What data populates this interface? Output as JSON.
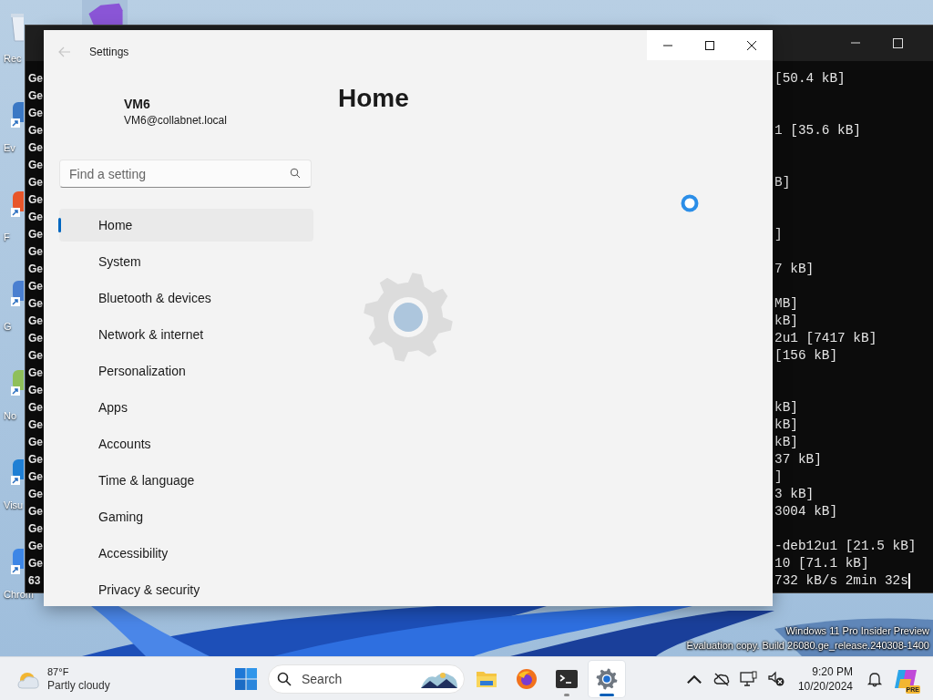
{
  "desktop": {
    "icons": [
      {
        "kind": "bin",
        "label": "Rec"
      },
      {
        "kind": "shortcut",
        "label": "Ev"
      },
      {
        "kind": "firefox",
        "label": "F"
      },
      {
        "kind": "globe",
        "label": "G"
      },
      {
        "kind": "notepad",
        "label": "No"
      },
      {
        "kind": "vscode",
        "label": "Visu"
      },
      {
        "kind": "chrome",
        "label": "Chrom"
      }
    ],
    "watermark": [
      "Windows 11 Pro Insider Preview",
      "Evaluation copy. Build 26080.ge_release.240308-1400"
    ]
  },
  "terminal": {
    "lines": [
      {
        "start": "Ge",
        "end": "[50.4 kB]"
      },
      {
        "start": "Ge"
      },
      {
        "start": "Ge"
      },
      {
        "start": "Ge",
        "end": "1 [35.6 kB]"
      },
      {
        "start": "Ge"
      },
      {
        "start": "Ge"
      },
      {
        "start": "Ge",
        "end": "B]"
      },
      {
        "start": "Ge"
      },
      {
        "start": "Ge"
      },
      {
        "start": "Ge",
        "end": "]"
      },
      {
        "start": "Ge"
      },
      {
        "start": "Ge",
        "end": "7 kB]"
      },
      {
        "start": "Ge"
      },
      {
        "start": "Ge",
        "end": "MB]"
      },
      {
        "start": "Ge",
        "end": "kB]"
      },
      {
        "start": "Ge",
        "end": "2u1 [7417 kB]"
      },
      {
        "start": "Ge",
        "end": "[156 kB]"
      },
      {
        "start": "Ge"
      },
      {
        "start": "Ge"
      },
      {
        "start": "Ge",
        "end": "kB]"
      },
      {
        "start": "Ge",
        "end": "kB]"
      },
      {
        "start": "Ge",
        "end": "kB]"
      },
      {
        "start": "Ge",
        "end": "37 kB]"
      },
      {
        "start": "Ge",
        "end": "]"
      },
      {
        "start": "Ge",
        "end": "3 kB]"
      },
      {
        "start": "Ge",
        "end": "3004 kB]"
      },
      {
        "start": "Ge"
      },
      {
        "start": "Ge",
        "end": "-deb12u1 [21.5 kB]"
      },
      {
        "start": "Ge",
        "end": "10 [71.1 kB]"
      },
      {
        "start": "63",
        "end": "732 kB/s 2min 32s",
        "cursor": true
      }
    ]
  },
  "settings": {
    "back": {
      "disabled": true
    },
    "title": "Settings",
    "user": {
      "name": "VM6",
      "email": "VM6@collabnet.local"
    },
    "search": {
      "placeholder": "Find a setting"
    },
    "nav": [
      {
        "label": "Home",
        "selected": true
      },
      {
        "label": "System",
        "selected": false
      },
      {
        "label": "Bluetooth & devices",
        "selected": false
      },
      {
        "label": "Network & internet",
        "selected": false
      },
      {
        "label": "Personalization",
        "selected": false
      },
      {
        "label": "Apps",
        "selected": false
      },
      {
        "label": "Accounts",
        "selected": false
      },
      {
        "label": "Time & language",
        "selected": false
      },
      {
        "label": "Gaming",
        "selected": false
      },
      {
        "label": "Accessibility",
        "selected": false
      },
      {
        "label": "Privacy & security",
        "selected": false
      }
    ],
    "page_title": "Home"
  },
  "taskbar": {
    "weather": {
      "temperature": "87°F",
      "condition": "Partly cloudy"
    },
    "search": {
      "placeholder": "Search"
    },
    "apps": [
      {
        "kind": "folder",
        "running": false,
        "selected": false
      },
      {
        "kind": "firefox",
        "running": false,
        "selected": false
      },
      {
        "kind": "terminal",
        "running": true,
        "selected": false
      },
      {
        "kind": "settings",
        "running": true,
        "selected": true
      }
    ],
    "clock": {
      "time": "9:20 PM",
      "date": "10/20/2024"
    },
    "copilot_badge": "PRE"
  }
}
